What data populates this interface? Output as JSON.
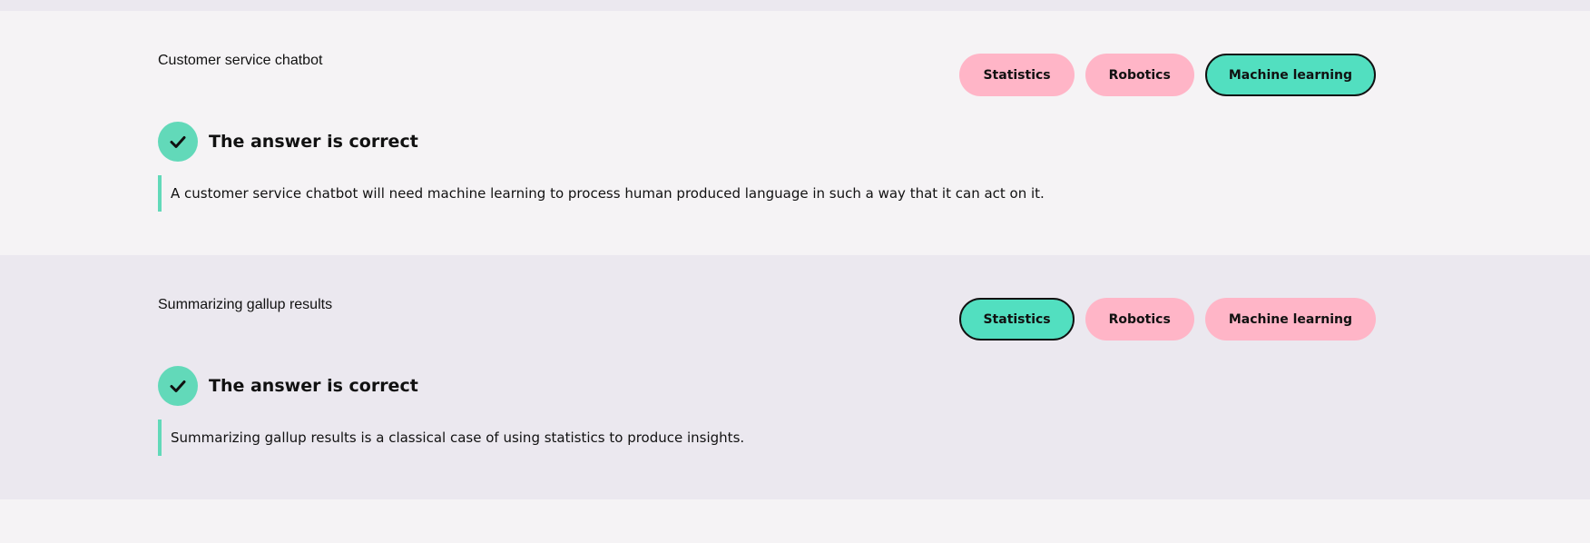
{
  "questions": [
    {
      "title": "Customer service chatbot",
      "options": [
        {
          "label": "Statistics",
          "selected": false
        },
        {
          "label": "Robotics",
          "selected": false
        },
        {
          "label": "Machine learning",
          "selected": true
        }
      ],
      "result": "The answer is correct",
      "explanation": "A customer service chatbot will need machine learning to process human produced language in such a way that it can act on it."
    },
    {
      "title": "Summarizing gallup results",
      "options": [
        {
          "label": "Statistics",
          "selected": true
        },
        {
          "label": "Robotics",
          "selected": false
        },
        {
          "label": "Machine learning",
          "selected": false
        }
      ],
      "result": "The answer is correct",
      "explanation": "Summarizing gallup results is a classical case of using statistics to produce insights."
    }
  ],
  "colors": {
    "correct": "#62d9b9",
    "selected_option": "#52dfc0",
    "unselected_option": "#ffb5c7",
    "card_light": "#f5f3f5",
    "card_dark": "#ebe8ef"
  },
  "icons": {
    "result": "checkmark-icon"
  }
}
